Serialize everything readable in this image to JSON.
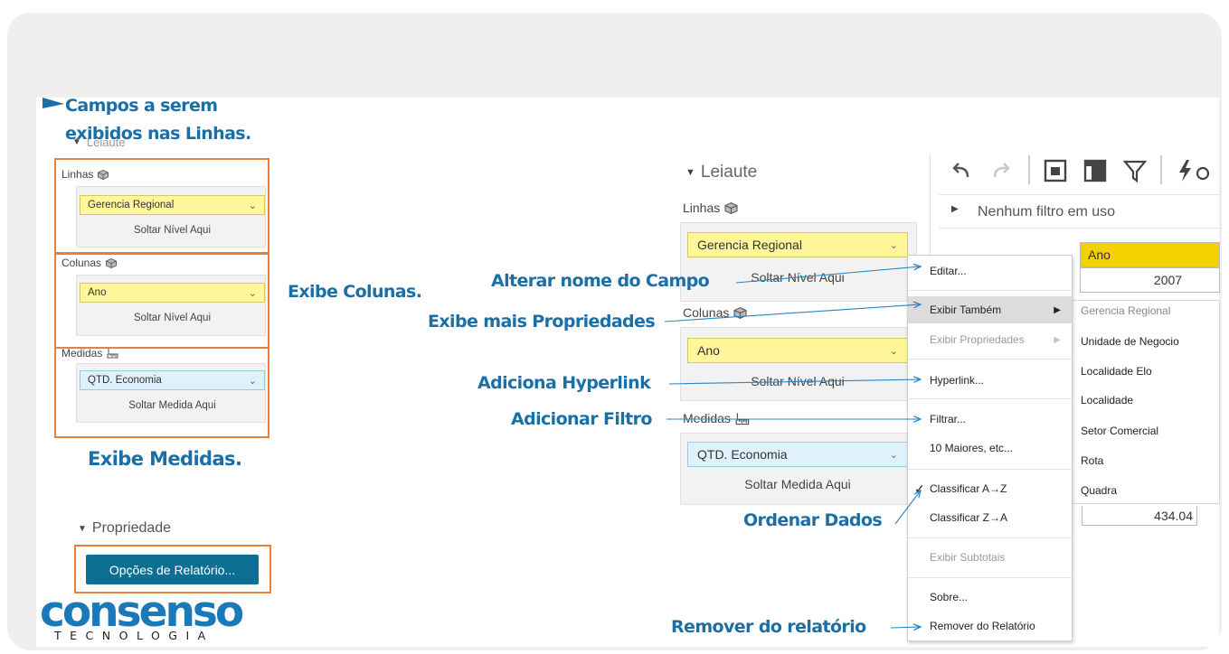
{
  "left_panel": {
    "layout_title": "Leiaute",
    "rows_label": "Linhas",
    "rows_field": "Gerencia Regional",
    "rows_drop": "Soltar Nível Aqui",
    "columns_label": "Colunas",
    "columns_field": "Ano",
    "columns_drop": "Soltar Nível Aqui",
    "measures_label": "Medidas",
    "measures_field": "QTD. Economia",
    "measures_drop": "Soltar Medida Aqui",
    "properties_title": "Propriedade",
    "report_options_button": "Opções de Relatório..."
  },
  "right_panel": {
    "layout_title": "Leiaute",
    "rows_label": "Linhas",
    "rows_field": "Gerencia Regional",
    "rows_drop": "Soltar Nível Aqui",
    "columns_label": "Colunas",
    "columns_field": "Ano",
    "columns_drop": "Soltar Nível Aqui",
    "measures_label": "Medidas",
    "measures_field": "QTD. Economia",
    "measures_drop": "Soltar Medida Aqui"
  },
  "filter_bar": {
    "text": "Nenhum filtro em uso"
  },
  "grid": {
    "header": "Ano",
    "year": "2007",
    "value": "434.04"
  },
  "context_menu": {
    "items": [
      "Editar...",
      "Exibir Também",
      "Exibir Propriedades",
      "Hyperlink...",
      "Filtrar...",
      "10 Maiores, etc...",
      "Classificar A→Z",
      "Classificar Z→A",
      "Exibir Subtotais",
      "Sobre...",
      "Remover do Relatório"
    ]
  },
  "submenu": {
    "items": [
      "Gerencia Regional",
      "Unidade de Negocio",
      "Localidade Elo",
      "Localidade",
      "Setor Comercial",
      "Rota",
      "Quadra"
    ]
  },
  "annotations": {
    "campos_line1": "Campos a serem",
    "campos_line2": "exibidos nas Linhas.",
    "exibe_colunas": "Exibe Colunas.",
    "exibe_medidas": "Exibe Medidas.",
    "alterar_nome": "Alterar nome do Campo",
    "exibe_mais": "Exibe mais Propriedades",
    "adiciona_hyperlink": "Adiciona Hyperlink",
    "adicionar_filtro": "Adicionar Filtro",
    "ordenar_dados": "Ordenar Dados",
    "remover": "Remover do relatório"
  },
  "logo": {
    "name": "consenso",
    "tagline": "TECNOLOGIA"
  },
  "colors": {
    "accent_blue": "#1a6fa7",
    "highlight_orange": "#e8803a",
    "button_blue": "#0e6f95",
    "field_yellow": "#fff79a",
    "field_blue": "#dff2fb"
  }
}
